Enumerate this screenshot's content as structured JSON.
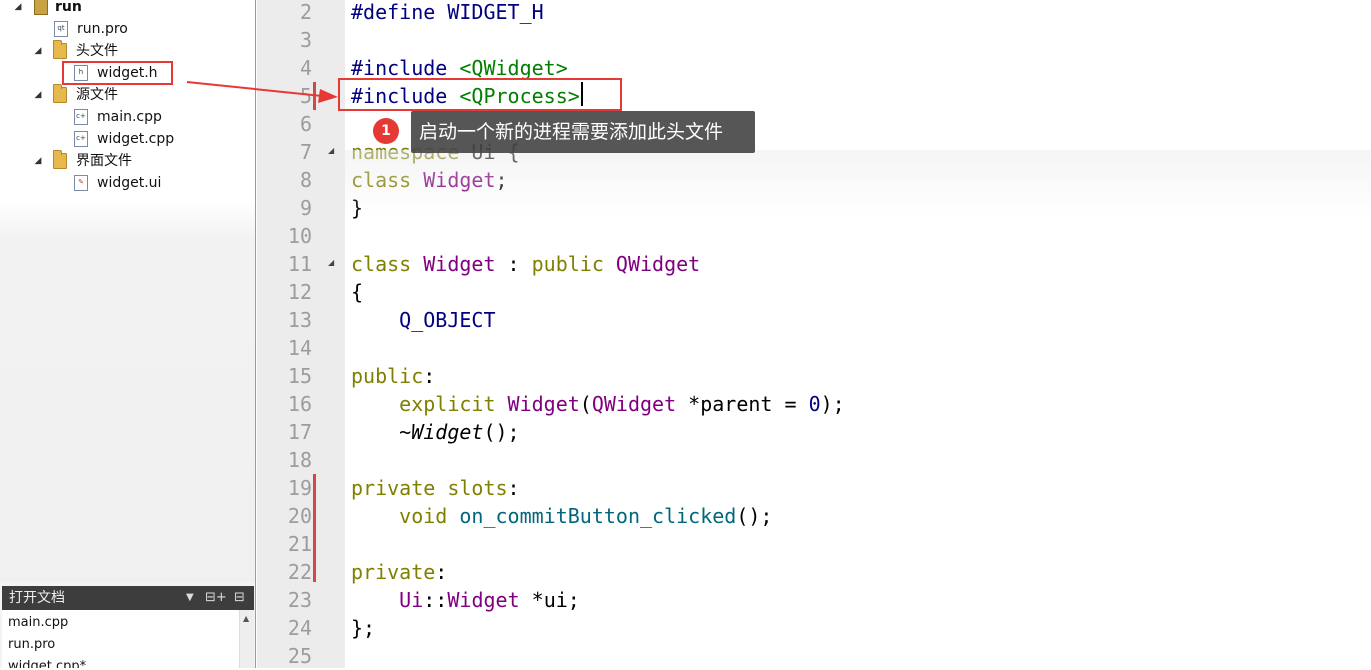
{
  "project_tree": {
    "items": [
      {
        "label": "run",
        "kind": "project"
      },
      {
        "label": "run.pro",
        "kind": "pro"
      },
      {
        "label": "头文件",
        "kind": "folder"
      },
      {
        "label": "widget.h",
        "kind": "header"
      },
      {
        "label": "源文件",
        "kind": "folder"
      },
      {
        "label": "main.cpp",
        "kind": "cpp"
      },
      {
        "label": "widget.cpp",
        "kind": "cpp"
      },
      {
        "label": "界面文件",
        "kind": "folder"
      },
      {
        "label": "widget.ui",
        "kind": "ui"
      }
    ]
  },
  "open_docs": {
    "title": "打开文档",
    "items": [
      "main.cpp",
      "run.pro",
      "widget.cpp*"
    ]
  },
  "editor": {
    "line_numbers": [
      "2",
      "3",
      "4",
      "5",
      "6",
      "7",
      "8",
      "9",
      "10",
      "11",
      "12",
      "13",
      "14",
      "15",
      "16",
      "17",
      "18",
      "19",
      "20",
      "21",
      "22",
      "23",
      "24",
      "25"
    ],
    "tokens": {
      "l2_a": "#define WIDGET_H",
      "l4_a": "#include ",
      "l4_b": "<QWidget>",
      "l5_a": "#include ",
      "l5_b": "<QProcess>",
      "l7_a": "namespace ",
      "l7_b": "Ui {",
      "l8_a": "class ",
      "l8_b": "Widget",
      "l8_c": ";",
      "l9_a": "}",
      "l11_a": "class ",
      "l11_b": "Widget",
      "l11_c": " : ",
      "l11_d": "public ",
      "l11_e": "QWidget",
      "l12_a": "{",
      "l13_a": "    Q_OBJECT",
      "l15_a": "public",
      "l15_b": ":",
      "l16_a": "    ",
      "l16_b": "explicit ",
      "l16_c": "Widget",
      "l16_d": "(",
      "l16_e": "QWidget",
      "l16_f": " *parent = ",
      "l16_g": "0",
      "l16_h": ");",
      "l17_a": "    ~",
      "l17_b": "Widget",
      "l17_c": "();",
      "l19_a": "private ",
      "l19_b": "slots",
      "l19_c": ":",
      "l20_a": "    ",
      "l20_b": "void ",
      "l20_c": "on_commitButton_clicked",
      "l20_d": "();",
      "l22_a": "private",
      "l22_b": ":",
      "l23_a": "    ",
      "l23_b": "Ui",
      "l23_c": "::",
      "l23_d": "Widget",
      "l23_e": " *ui;",
      "l24_a": "};"
    }
  },
  "annotation": {
    "badge": "1",
    "text": "启动一个新的进程需要添加此头文件",
    "color": "#e53935"
  }
}
